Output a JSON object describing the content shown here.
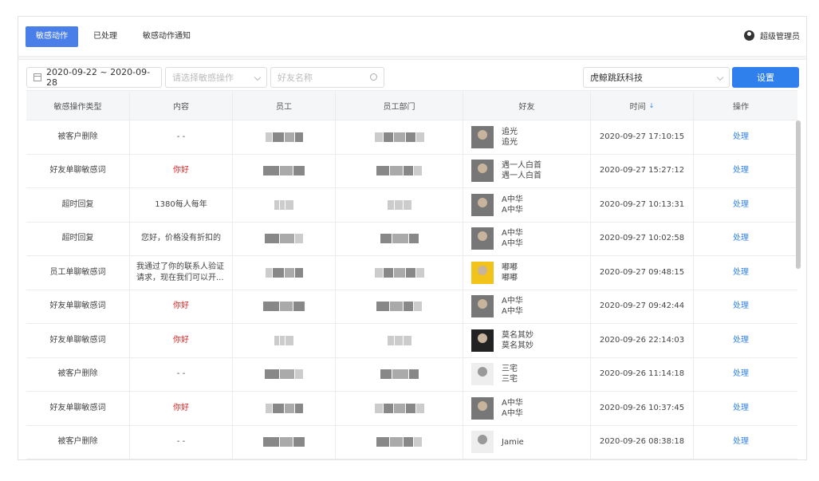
{
  "tabs": [
    {
      "label": "敏感动作",
      "active": true
    },
    {
      "label": "已处理",
      "active": false
    },
    {
      "label": "敏感动作通知",
      "active": false
    }
  ],
  "user": {
    "name": "超级管理员",
    "icon": "user-icon"
  },
  "filters": {
    "date_range": "2020-09-22 ~ 2020-09-28",
    "operation_placeholder": "请选择敏感操作",
    "friend_placeholder": "好友名称",
    "company": "虎鲸跳跃科技",
    "settings_button": "设置"
  },
  "table": {
    "headers": [
      "敏感操作类型",
      "内容",
      "员工",
      "员工部门",
      "好友",
      "时间",
      "操作"
    ],
    "sort_indicator": "↓",
    "rows": [
      {
        "type": "被客户删除",
        "content": "- -",
        "content_red": false,
        "friend": [
          "追光",
          "追光"
        ],
        "time": "2020-09-27 17:10:15",
        "action": "处理",
        "avatar": "gray"
      },
      {
        "type": "好友单聊敏感词",
        "content": "你好",
        "content_red": true,
        "friend": [
          "遇一人白首",
          "遇一人白首"
        ],
        "time": "2020-09-27 15:27:12",
        "action": "处理",
        "avatar": "gray"
      },
      {
        "type": "超时回复",
        "content": "1380每人每年",
        "content_red": false,
        "friend": [
          "A中华",
          "A中华"
        ],
        "time": "2020-09-27 10:13:31",
        "action": "处理",
        "avatar": "gray"
      },
      {
        "type": "超时回复",
        "content": "您好，价格没有折扣的",
        "content_red": false,
        "friend": [
          "A中华",
          "A中华"
        ],
        "time": "2020-09-27 10:02:58",
        "action": "处理",
        "avatar": "gray"
      },
      {
        "type": "员工单聊敏感词",
        "content": "我通过了你的联系人验证请求，现在我们可以开...",
        "content_red": false,
        "friend": [
          "嘟嘟",
          "嘟嘟"
        ],
        "time": "2020-09-27 09:48:15",
        "action": "处理",
        "avatar": "yel"
      },
      {
        "type": "好友单聊敏感词",
        "content": "你好",
        "content_red": true,
        "friend": [
          "A中华",
          "A中华"
        ],
        "time": "2020-09-27 09:42:44",
        "action": "处理",
        "avatar": "gray"
      },
      {
        "type": "好友单聊敏感词",
        "content": "你好",
        "content_red": true,
        "friend": [
          "莫名其妙",
          "莫名其妙"
        ],
        "time": "2020-09-26 22:14:03",
        "action": "处理",
        "avatar": "dark"
      },
      {
        "type": "被客户删除",
        "content": "- -",
        "content_red": false,
        "friend": [
          "三宅",
          "三宅"
        ],
        "time": "2020-09-26 11:14:18",
        "action": "处理",
        "avatar": "light"
      },
      {
        "type": "好友单聊敏感词",
        "content": "你好",
        "content_red": true,
        "friend": [
          "A中华",
          "A中华"
        ],
        "time": "2020-09-26 10:37:45",
        "action": "处理",
        "avatar": "gray"
      },
      {
        "type": "被客户删除",
        "content": "- -",
        "content_red": false,
        "friend": [
          "Jamie"
        ],
        "time": "2020-09-26 08:38:18",
        "action": "处理",
        "avatar": "light"
      }
    ]
  }
}
